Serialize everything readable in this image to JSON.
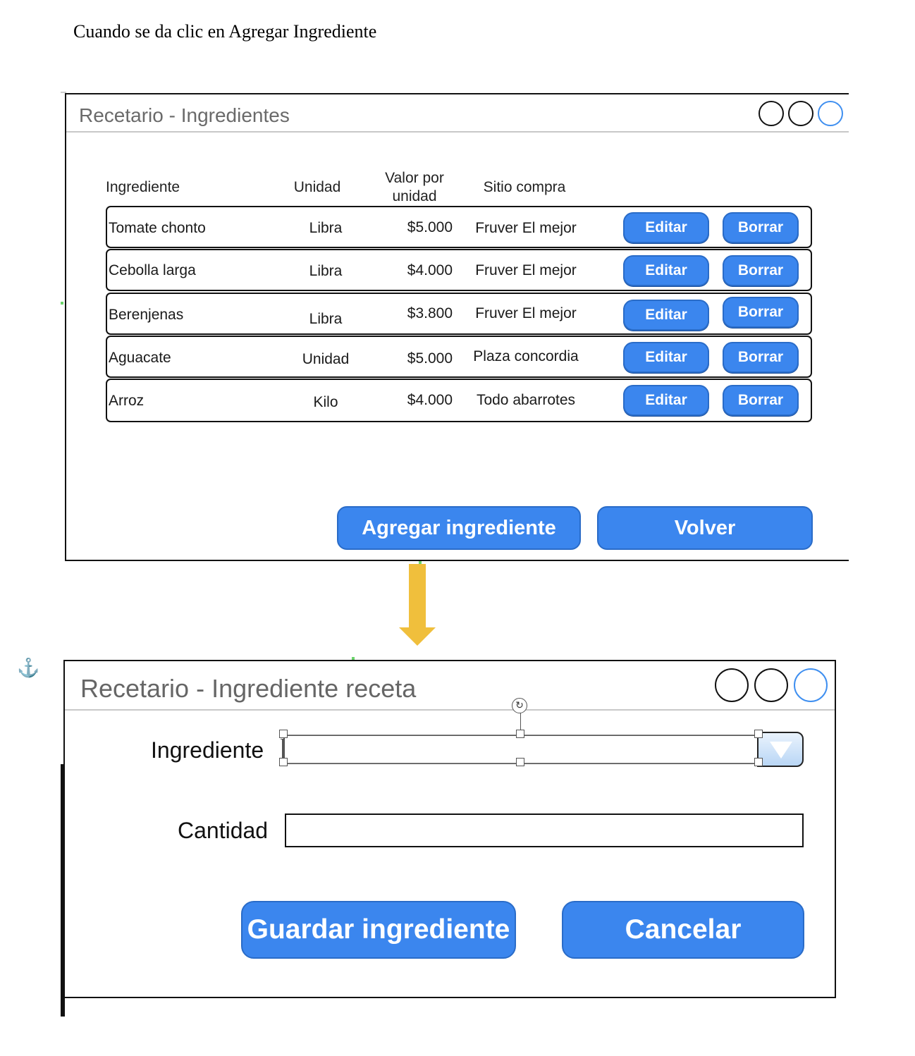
{
  "caption": "Cuando se da clic en Agregar Ingrediente",
  "window1": {
    "title": "Recetario - Ingredientes",
    "headers": {
      "ingrediente": "Ingrediente",
      "unidad": "Unidad",
      "valor_line1": "Valor por",
      "valor_line2": "unidad",
      "sitio": "Sitio compra"
    },
    "rows": [
      {
        "ingrediente": "Tomate chonto",
        "unidad": "Libra",
        "valor": "$5.000",
        "sitio": "Fruver El mejor",
        "edit": "Editar",
        "delete": "Borrar"
      },
      {
        "ingrediente": "Cebolla larga",
        "unidad": "Libra",
        "valor": "$4.000",
        "sitio": "Fruver El mejor",
        "edit": "Editar",
        "delete": "Borrar"
      },
      {
        "ingrediente": "Berenjenas",
        "unidad": "Libra",
        "valor": "$3.800",
        "sitio": "Fruver El mejor",
        "edit": "Editar",
        "delete": "Borrar"
      },
      {
        "ingrediente": "Aguacate",
        "unidad": "Unidad",
        "valor": "$5.000",
        "sitio": "Plaza concordia",
        "edit": "Editar",
        "delete": "Borrar"
      },
      {
        "ingrediente": "Arroz",
        "unidad": "Kilo",
        "valor": "$4.000",
        "sitio": "Todo abarrotes",
        "edit": "Editar",
        "delete": "Borrar"
      }
    ],
    "add_button": "Agregar ingrediente",
    "back_button": "Volver"
  },
  "window2": {
    "title": "Recetario - Ingrediente receta",
    "ingrediente_label": "Ingrediente",
    "ingrediente_value": "",
    "cantidad_label": "Cantidad",
    "cantidad_value": "",
    "save_button": "Guardar ingrediente",
    "cancel_button": "Cancelar"
  },
  "icons": {
    "arrow": "down-arrow-icon",
    "anchor": "anchor-icon",
    "window_controls": "circle-icon"
  },
  "colors": {
    "button_blue": "#3b86ee",
    "arrow_yellow": "#f0bf3c",
    "title_gray": "#6a6a6a"
  }
}
